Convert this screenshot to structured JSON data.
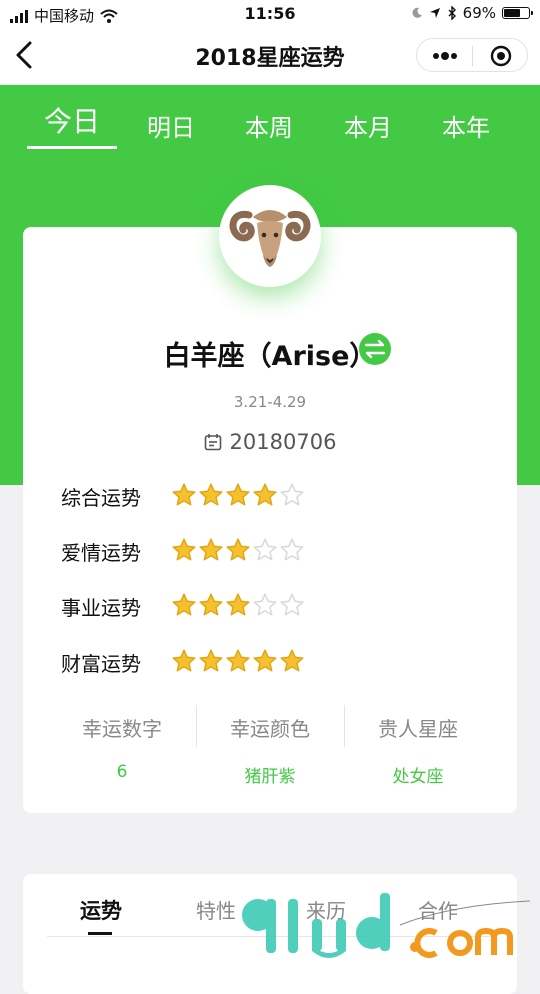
{
  "status_bar": {
    "carrier": "中国移动",
    "time": "11:56",
    "battery": "69%",
    "battery_level": 0.69,
    "icons": [
      "signal-icon",
      "wifi-icon",
      "moon-icon",
      "location-icon",
      "bluetooth-icon",
      "battery-icon"
    ]
  },
  "navbar": {
    "title": "2018星座运势",
    "icons": [
      "back-arrow-icon",
      "more-dots-icon",
      "target-icon"
    ]
  },
  "tabs": [
    {
      "label": "今日",
      "active": true
    },
    {
      "label": "明日",
      "active": false
    },
    {
      "label": "本周",
      "active": false
    },
    {
      "label": "本月",
      "active": false
    },
    {
      "label": "本年",
      "active": false
    }
  ],
  "sign": {
    "name": "白羊座（Arise）",
    "dates": "3.21-4.29",
    "today": "20180706",
    "icon": "ram-icon"
  },
  "fortunes": [
    {
      "label": "综合运势",
      "stars": 4,
      "max": 5
    },
    {
      "label": "爱情运势",
      "stars": 3,
      "max": 5
    },
    {
      "label": "事业运势",
      "stars": 3,
      "max": 5
    },
    {
      "label": "财富运势",
      "stars": 5,
      "max": 5
    }
  ],
  "lucky": [
    {
      "title": "幸运数字",
      "value": "6"
    },
    {
      "title": "幸运颜色",
      "value": "猪肝紫"
    },
    {
      "title": "贵人星座",
      "value": "处女座"
    }
  ],
  "bottom_tabs": [
    {
      "label": "运势",
      "active": true
    },
    {
      "label": "特性",
      "active": false
    },
    {
      "label": "来历",
      "active": false
    },
    {
      "label": "合作",
      "active": false
    }
  ],
  "colors": {
    "accent": "#43c944",
    "star_fill": "#f6c12c",
    "star_empty": "#d9d9d9"
  }
}
